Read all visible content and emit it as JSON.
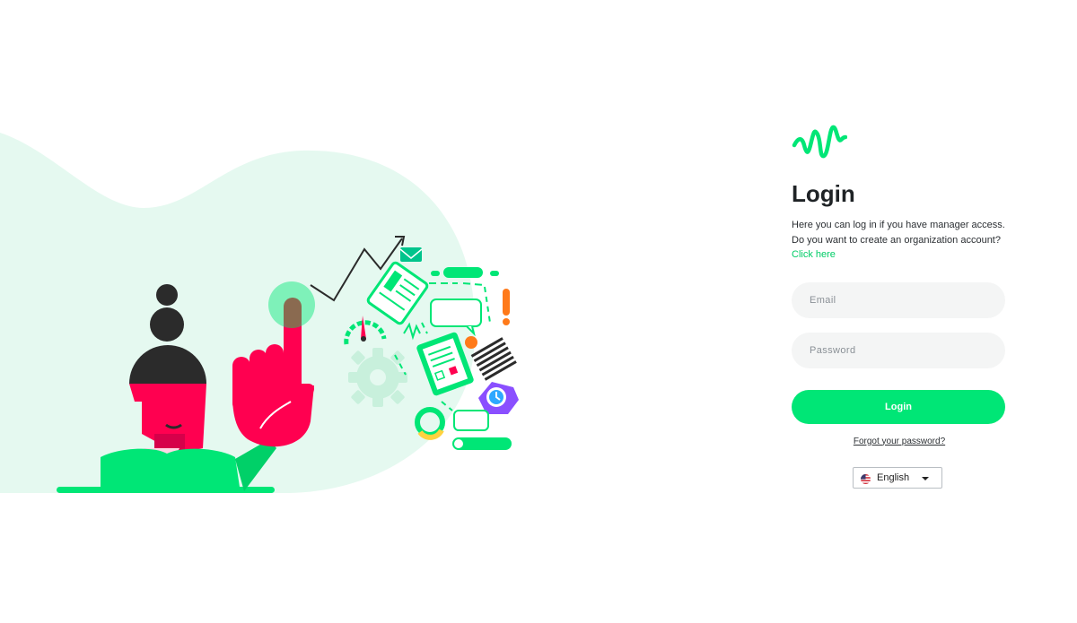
{
  "brand": {
    "logo_icon": "waveform-icon",
    "accent_color": "#00e676",
    "link_color": "#00cc66"
  },
  "login": {
    "title": "Login",
    "intro_line1": "Here you can log in if you have manager access.",
    "intro_line2": "Do you want to create an organization account?",
    "create_link": "Click here",
    "email_placeholder": "Email",
    "email_value": "",
    "password_placeholder": "Password",
    "password_value": "",
    "submit_label": "Login",
    "forgot_label": "Forgot your password?"
  },
  "language": {
    "selected": "English",
    "flag_icon": "us-flag-icon",
    "caret_icon": "caret-down-icon"
  },
  "illustration": {
    "subject": "woman-pointing-illustration",
    "background_color": "#e5f9f0"
  }
}
